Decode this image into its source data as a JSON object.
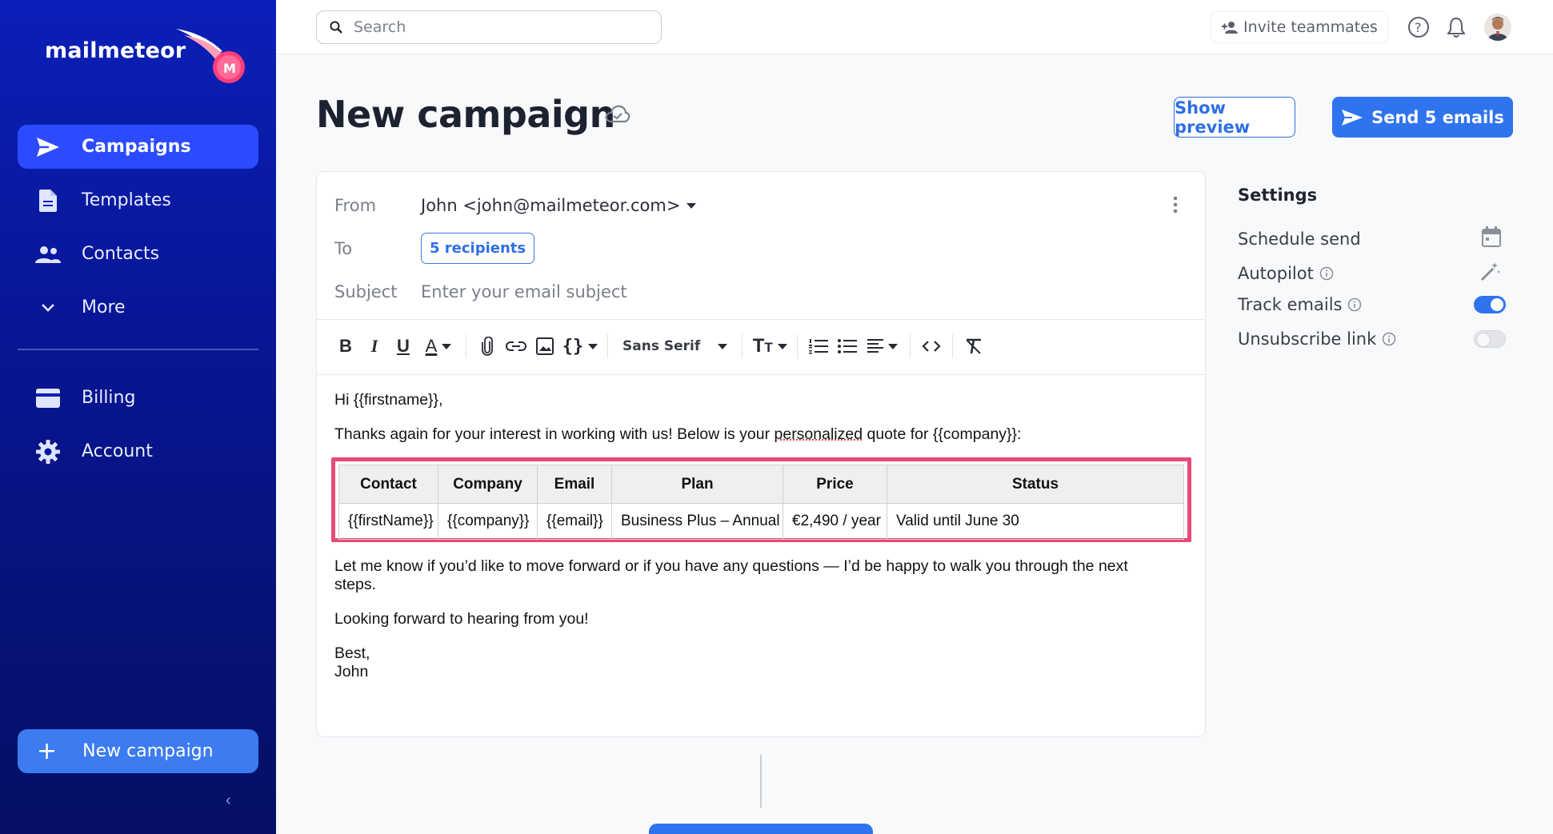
{
  "brand": {
    "name": "mailmeteor",
    "accent": "#2f74ee",
    "sidebar_bg": "#0a1fb8"
  },
  "sidebar": {
    "items": [
      {
        "label": "Campaigns",
        "icon": "send-icon",
        "active": true
      },
      {
        "label": "Templates",
        "icon": "document-icon",
        "active": false
      },
      {
        "label": "Contacts",
        "icon": "people-icon",
        "active": false
      },
      {
        "label": "More",
        "icon": "chevron-down-icon",
        "active": false
      }
    ],
    "items2": [
      {
        "label": "Billing",
        "icon": "credit-card-icon"
      },
      {
        "label": "Account",
        "icon": "gear-icon"
      }
    ],
    "new_campaign_label": "New campaign"
  },
  "topbar": {
    "search_placeholder": "Search",
    "invite_label": "Invite teammates"
  },
  "header": {
    "title": "New campaign",
    "preview_label": "Show preview",
    "send_label": "Send 5 emails"
  },
  "composer": {
    "from_label": "From",
    "from_value": "John <john@mailmeteor.com>",
    "to_label": "To",
    "recipients_label": "5 recipients",
    "subject_label": "Subject",
    "subject_placeholder": "Enter your email subject",
    "font_name": "Sans Serif"
  },
  "email": {
    "greeting": "Hi {{firstname}},",
    "intro_before": "Thanks again for your interest in working with us! Below is your ",
    "intro_squiggle": "personalized",
    "intro_after": " quote for {{company}}:",
    "table": {
      "headers": [
        "Contact",
        "Company",
        "Email",
        "Plan",
        "Price",
        "Status"
      ],
      "row": [
        "{{firstName}}",
        "{{company}}",
        "{{email}}",
        "Business Plus – Annual",
        "€2,490 / year",
        "Valid until June 30"
      ]
    },
    "followup": "Let me know if you’d like to move forward or if you have any questions — I’d be happy to walk you through the next steps.",
    "closing": "Looking forward to hearing from you!",
    "signoff": "Best,",
    "signature": "John"
  },
  "settings": {
    "title": "Settings",
    "schedule_label": "Schedule send",
    "autopilot_label": "Autopilot",
    "track_label": "Track emails",
    "track_on": true,
    "unsubscribe_label": "Unsubscribe link",
    "unsubscribe_on": false
  }
}
